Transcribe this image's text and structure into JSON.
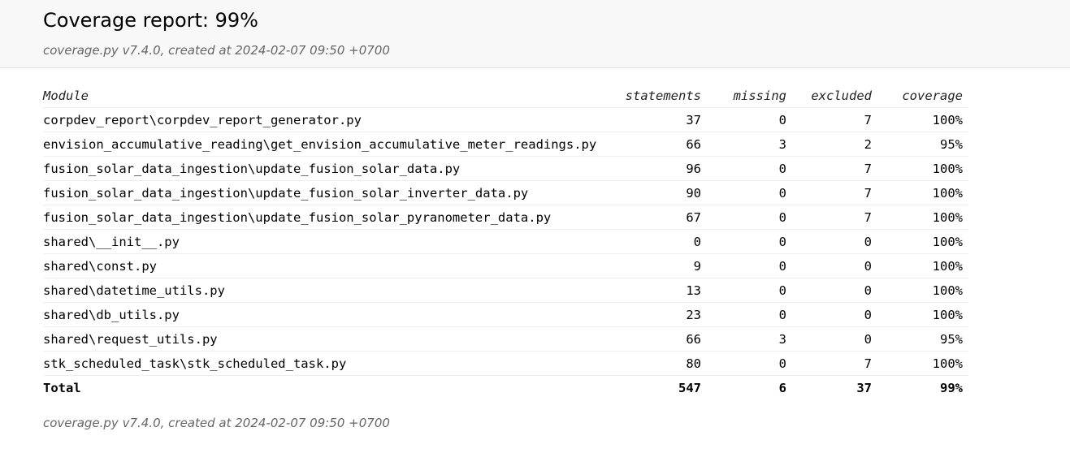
{
  "header": {
    "title": "Coverage report: 99%",
    "created": "coverage.py v7.4.0, created at 2024-02-07 09:50 +0700"
  },
  "table": {
    "columns": [
      "Module",
      "statements",
      "missing",
      "excluded",
      "coverage"
    ],
    "rows": [
      {
        "module": "corpdev_report\\corpdev_report_generator.py",
        "statements": "37",
        "missing": "0",
        "excluded": "7",
        "coverage": "100%"
      },
      {
        "module": "envision_accumulative_reading\\get_envision_accumulative_meter_readings.py",
        "statements": "66",
        "missing": "3",
        "excluded": "2",
        "coverage": "95%"
      },
      {
        "module": "fusion_solar_data_ingestion\\update_fusion_solar_data.py",
        "statements": "96",
        "missing": "0",
        "excluded": "7",
        "coverage": "100%"
      },
      {
        "module": "fusion_solar_data_ingestion\\update_fusion_solar_inverter_data.py",
        "statements": "90",
        "missing": "0",
        "excluded": "7",
        "coverage": "100%"
      },
      {
        "module": "fusion_solar_data_ingestion\\update_fusion_solar_pyranometer_data.py",
        "statements": "67",
        "missing": "0",
        "excluded": "7",
        "coverage": "100%"
      },
      {
        "module": "shared\\__init__.py",
        "statements": "0",
        "missing": "0",
        "excluded": "0",
        "coverage": "100%"
      },
      {
        "module": "shared\\const.py",
        "statements": "9",
        "missing": "0",
        "excluded": "0",
        "coverage": "100%"
      },
      {
        "module": "shared\\datetime_utils.py",
        "statements": "13",
        "missing": "0",
        "excluded": "0",
        "coverage": "100%"
      },
      {
        "module": "shared\\db_utils.py",
        "statements": "23",
        "missing": "0",
        "excluded": "0",
        "coverage": "100%"
      },
      {
        "module": "shared\\request_utils.py",
        "statements": "66",
        "missing": "3",
        "excluded": "0",
        "coverage": "95%"
      },
      {
        "module": "stk_scheduled_task\\stk_scheduled_task.py",
        "statements": "80",
        "missing": "0",
        "excluded": "7",
        "coverage": "100%"
      }
    ],
    "total": {
      "module": "Total",
      "statements": "547",
      "missing": "6",
      "excluded": "37",
      "coverage": "99%"
    }
  },
  "footer": {
    "created": "coverage.py v7.4.0, created at 2024-02-07 09:50 +0700"
  }
}
